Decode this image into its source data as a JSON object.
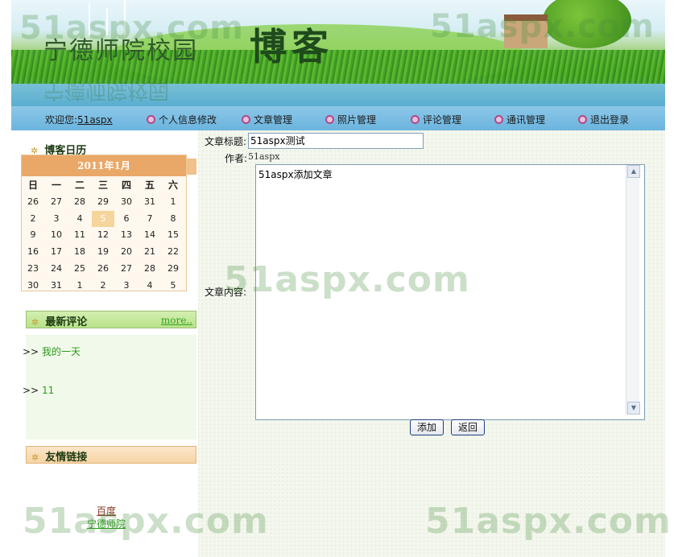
{
  "banner": {
    "title_small": "宁德师院校园",
    "title_big": "博客"
  },
  "watermark": "51aspx.com",
  "nav": {
    "welcome_label": "欢迎您:",
    "username": "51aspx",
    "items": [
      "个人信息修改",
      "文章管理",
      "照片管理",
      "评论管理",
      "通讯管理",
      "退出登录"
    ]
  },
  "sidebar": {
    "calendar": {
      "title": "博客日历",
      "month": "2011年1月",
      "weekdays": [
        "日",
        "一",
        "二",
        "三",
        "四",
        "五",
        "六"
      ],
      "weeks": [
        [
          "26",
          "27",
          "28",
          "29",
          "30",
          "31",
          "1"
        ],
        [
          "2",
          "3",
          "4",
          "5",
          "6",
          "7",
          "8"
        ],
        [
          "9",
          "10",
          "11",
          "12",
          "13",
          "14",
          "15"
        ],
        [
          "16",
          "17",
          "18",
          "19",
          "20",
          "21",
          "22"
        ],
        [
          "23",
          "24",
          "25",
          "26",
          "27",
          "28",
          "29"
        ],
        [
          "30",
          "31",
          "1",
          "2",
          "3",
          "4",
          "5"
        ]
      ],
      "today": "5"
    },
    "latest_comments": {
      "title": "最新评论",
      "more": "more..",
      "items": [
        {
          "prefix": ">>",
          "text": "我的一天"
        },
        {
          "prefix": ">>",
          "text": "11"
        }
      ]
    },
    "friend_links": {
      "title": "友情链接",
      "items": [
        {
          "text": "百度",
          "color": "#8a3a2a"
        },
        {
          "text": "宁德师院",
          "color": "#2a9a1a"
        }
      ]
    }
  },
  "form": {
    "title_label": "文章标题:",
    "title_value": "51aspx测试",
    "author_label": "作者:",
    "author_value": "51aspx",
    "content_label": "文章内容:",
    "content_value": "51aspx添加文章",
    "add_button": "添加",
    "back_button": "返回"
  }
}
